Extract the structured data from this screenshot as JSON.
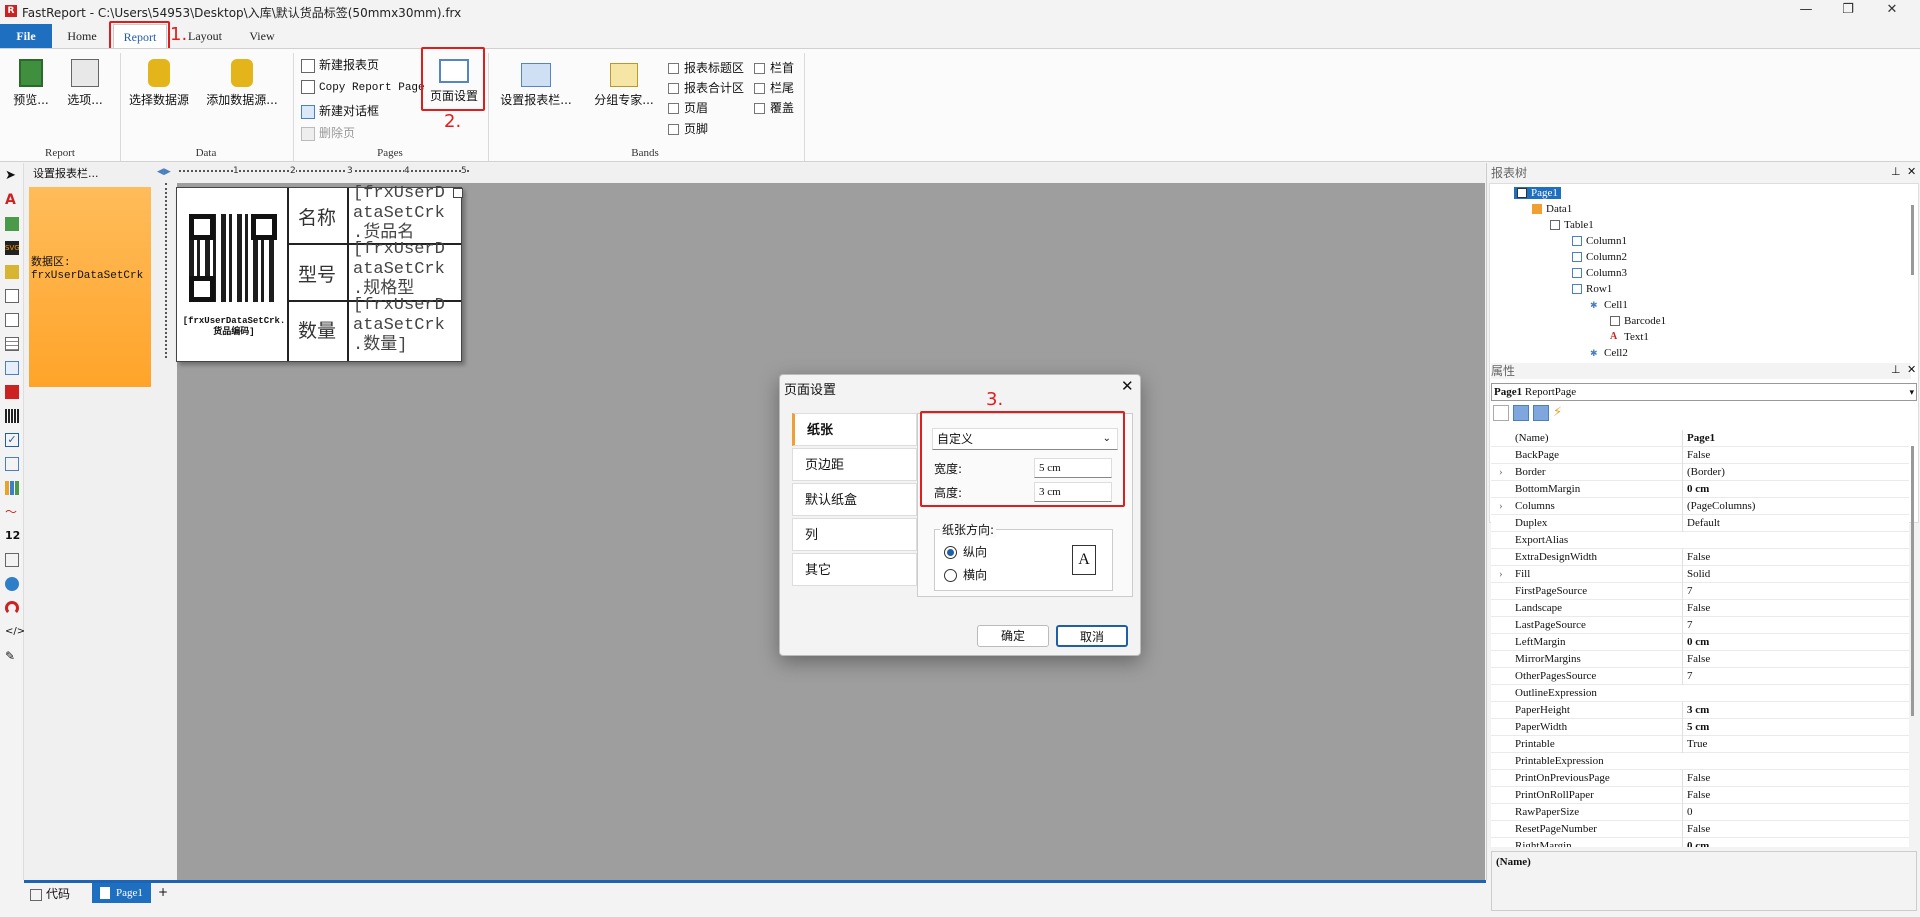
{
  "window": {
    "title": "FastReport - C:\\Users\\54953\\Desktop\\入库\\默认货品标签(50mmx30mm).frx"
  },
  "tabs": [
    "File",
    "Home",
    "Report",
    "Layout",
    "View"
  ],
  "ribbon": {
    "report": {
      "label": "Report",
      "preview": "预览...",
      "options": "选项..."
    },
    "data": {
      "label": "Data",
      "choose": "选择数据源",
      "add": "添加数据源..."
    },
    "pages": {
      "label": "Pages",
      "new_page": "新建报表页",
      "copy_page": "Copy Report Page",
      "new_dialog": "新建对话框",
      "delete_page": "删除页",
      "page_setup": "页面设置"
    },
    "bands": {
      "label": "Bands",
      "setup_bands": "设置报表栏...",
      "group_expert": "分组专家...",
      "report_title": "报表标题区",
      "report_summary": "报表合计区",
      "page_header": "页眉",
      "page_footer": "页脚",
      "column_header": "栏首",
      "column_footer": "栏尾",
      "overlay": "覆盖"
    }
  },
  "annotations": {
    "a1": "1.",
    "a2": "2.",
    "a3": "3."
  },
  "band_panel": {
    "header": "设置报表栏...",
    "band_label": "数据区:",
    "band_source": "frxUserDataSetCrk"
  },
  "ruler_ticks": [
    "1",
    "2",
    "3",
    "4",
    "5"
  ],
  "label_page": {
    "qr_caption_1": "[frxUserDataSetCrk.",
    "qr_caption_2": "货品编码]",
    "row_labels": [
      "名称",
      "型号",
      "数量"
    ],
    "row_fields": [
      "[frxUserD ataSetCrk .货品名",
      "[frxUserD ataSetCrk .规格型",
      "[frxUserD ataSetCrk .数量]"
    ]
  },
  "report_tree": {
    "header": "报表树",
    "items": [
      "Page1",
      "Data1",
      "Table1",
      "Column1",
      "Column2",
      "Column3",
      "Row1",
      "Cell1",
      "Barcode1",
      "Text1",
      "Cell2"
    ]
  },
  "properties": {
    "header": "属性",
    "object": "Page1",
    "object_type": "ReportPage",
    "rows": [
      [
        "(Name)",
        "Page1"
      ],
      [
        "BackPage",
        "False"
      ],
      [
        "Border",
        "(Border)"
      ],
      [
        "BottomMargin",
        "0 cm"
      ],
      [
        "Columns",
        "(PageColumns)"
      ],
      [
        "Duplex",
        "Default"
      ],
      [
        "ExportAlias",
        ""
      ],
      [
        "ExtraDesignWidth",
        "False"
      ],
      [
        "Fill",
        "Solid"
      ],
      [
        "FirstPageSource",
        "7"
      ],
      [
        "Landscape",
        "False"
      ],
      [
        "LastPageSource",
        "7"
      ],
      [
        "LeftMargin",
        "0 cm"
      ],
      [
        "MirrorMargins",
        "False"
      ],
      [
        "OtherPagesSource",
        "7"
      ],
      [
        "OutlineExpression",
        ""
      ],
      [
        "PaperHeight",
        "3 cm"
      ],
      [
        "PaperWidth",
        "5 cm"
      ],
      [
        "Printable",
        "True"
      ],
      [
        "PrintableExpression",
        ""
      ],
      [
        "PrintOnPreviousPage",
        "False"
      ],
      [
        "PrintOnRollPaper",
        "False"
      ],
      [
        "RawPaperSize",
        "0"
      ],
      [
        "ResetPageNumber",
        "False"
      ],
      [
        "RightMargin",
        "0 cm"
      ]
    ],
    "description": "(Name)"
  },
  "bottom_tabs": {
    "code": "代码",
    "page": "Page1",
    "add": "+"
  },
  "dialog": {
    "title": "页面设置",
    "nav": [
      "纸张",
      "页边距",
      "默认纸盒",
      "列",
      "其它"
    ],
    "paper_size": "自定义",
    "width_label": "宽度:",
    "width_value": "5 cm",
    "height_label": "高度:",
    "height_value": "3 cm",
    "orientation_label": "纸张方向:",
    "portrait": "纵向",
    "landscape": "横向",
    "ok": "确定",
    "cancel": "取消"
  }
}
